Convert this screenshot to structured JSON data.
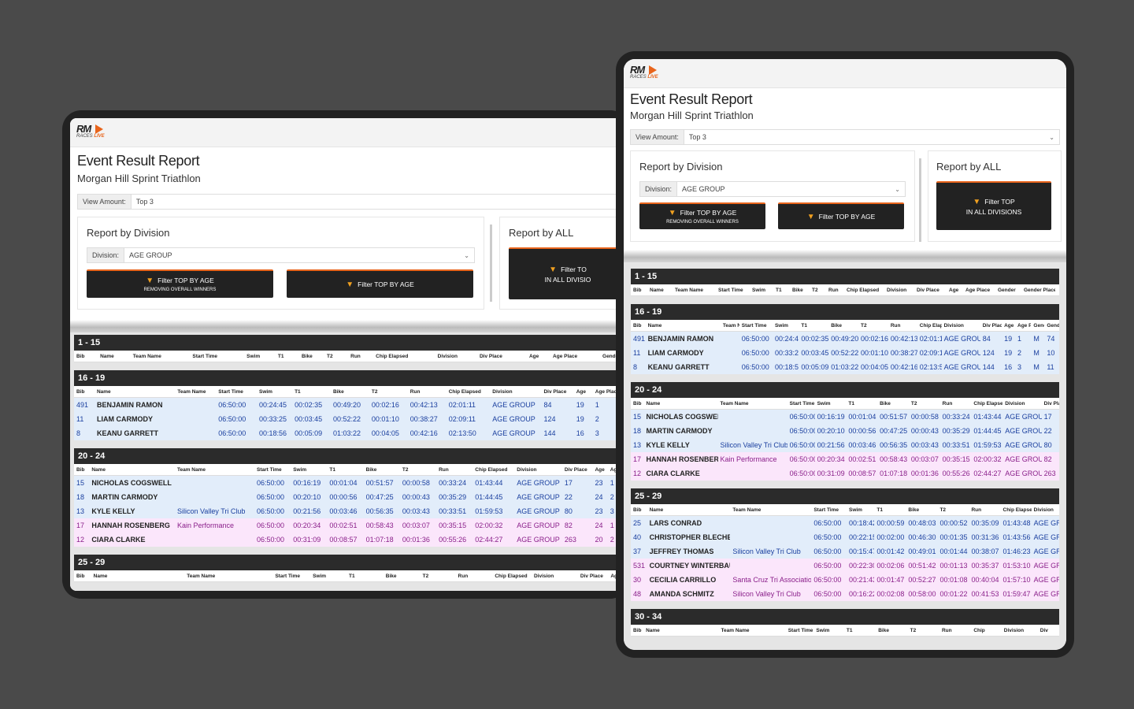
{
  "logo": {
    "mark": "RM",
    "sub_a": "RACES",
    "sub_b": "LIVE"
  },
  "report": {
    "title": "Event Result Report",
    "subtitle": "Morgan Hill Sprint Triathlon",
    "view_amount_label": "View Amount:",
    "view_amount_value": "Top 3",
    "by_division_title": "Report by Division",
    "division_label": "Division:",
    "division_value": "AGE GROUP",
    "btn_filter_top_removing": "Filter TOP BY AGE",
    "btn_filter_top_removing_sub": "REMOVING OVERALL WINNERS",
    "btn_filter_top": "Filter TOP BY AGE",
    "by_all_title": "Report by ALL",
    "btn_all_line1": "Filter TOP",
    "btn_all_line2": "IN ALL DIVISIONS",
    "btn_all_left_line1": "Filter TO",
    "btn_all_left_line2": "IN ALL DIVISIO"
  },
  "columns": [
    "Bib",
    "Name",
    "Team Name",
    "Start Time",
    "Swim",
    "T1",
    "Bike",
    "T2",
    "Run",
    "Chip Elapsed",
    "Division",
    "Div Place",
    "Age",
    "Age Place",
    "Gender",
    "Gender Place"
  ],
  "columns_right_16": [
    "Bib",
    "Name",
    "Team Name",
    "Start Time",
    "Swim",
    "T1",
    "Bike",
    "T2",
    "Run",
    "Chip Elapsed",
    "Division",
    "Div Place",
    "Age",
    "Age Place",
    "Gender",
    "Gender Pla"
  ],
  "columns_right_20": [
    "Bib",
    "Name",
    "Team Name",
    "Start Time",
    "Swim",
    "T1",
    "Bike",
    "T2",
    "Run",
    "Chip Elapsed",
    "Division",
    "Div Place"
  ],
  "columns_right_25": [
    "Bib",
    "Name",
    "Team Name",
    "Start Time",
    "Swim",
    "T1",
    "Bike",
    "T2",
    "Run",
    "Chip Elapsed",
    "Division"
  ],
  "columns_right_30": [
    "Bib",
    "Name",
    "Team Name",
    "Start Time",
    "Swim",
    "T1",
    "Bike",
    "T2",
    "Run",
    "Chip",
    "Division",
    "Div"
  ],
  "columns_left_1": [
    "Bib",
    "Name",
    "Team Name",
    "Start Time",
    "Swim",
    "T1",
    "Bike",
    "T2",
    "Run",
    "Chip Elapsed",
    "Division",
    "Div Place",
    "Age",
    "Age Place",
    "Gender"
  ],
  "columns_left_16": [
    "Bib",
    "Name",
    "Team Name",
    "Start Time",
    "Swim",
    "T1",
    "Bike",
    "T2",
    "Run",
    "Chip Elapsed",
    "Division",
    "Div Place",
    "Age",
    "Age Place"
  ],
  "columns_left_20": [
    "Bib",
    "Name",
    "Team Name",
    "Start Time",
    "Swim",
    "T1",
    "Bike",
    "T2",
    "Run",
    "Chip Elapsed",
    "Division",
    "Div Place",
    "Age",
    "Age Pl"
  ],
  "columns_left_25": [
    "Bib",
    "Name",
    "Team Name",
    "Start Time",
    "Swim",
    "T1",
    "Bike",
    "T2",
    "Run",
    "Chip Elapsed",
    "Division",
    "Div Place",
    "Age"
  ],
  "groups": [
    {
      "label": "1 - 15",
      "rows": []
    },
    {
      "label": "16 - 19",
      "rows": [
        {
          "g": "m",
          "bib": "491",
          "name": "BENJAMIN RAMON",
          "team": "",
          "start": "06:50:00",
          "swim": "00:24:45",
          "t1": "00:02:35",
          "bike": "00:49:20",
          "t2": "00:02:16",
          "run": "00:42:13",
          "chip": "02:01:11",
          "div": "AGE GROUP",
          "divp": "84",
          "age": "19",
          "agep": "1",
          "gender": "M",
          "genp": "74"
        },
        {
          "g": "m",
          "bib": "11",
          "name": "LIAM CARMODY",
          "team": "",
          "start": "06:50:00",
          "swim": "00:33:25",
          "t1": "00:03:45",
          "bike": "00:52:22",
          "t2": "00:01:10",
          "run": "00:38:27",
          "chip": "02:09:11",
          "div": "AGE GROUP",
          "divp": "124",
          "age": "19",
          "agep": "2",
          "gender": "M",
          "genp": "10"
        },
        {
          "g": "m",
          "bib": "8",
          "name": "KEANU GARRETT",
          "team": "",
          "start": "06:50:00",
          "swim": "00:18:56",
          "t1": "00:05:09",
          "bike": "01:03:22",
          "t2": "00:04:05",
          "run": "00:42:16",
          "chip": "02:13:50",
          "div": "AGE GROUP",
          "divp": "144",
          "age": "16",
          "agep": "3",
          "gender": "M",
          "genp": "11"
        }
      ]
    },
    {
      "label": "20 - 24",
      "rows": [
        {
          "g": "m",
          "bib": "15",
          "name": "NICHOLAS COGSWELL",
          "team": "",
          "start": "06:50:00",
          "swim": "00:16:19",
          "t1": "00:01:04",
          "bike": "00:51:57",
          "t2": "00:00:58",
          "run": "00:33:24",
          "chip": "01:43:44",
          "div": "AGE GROUP",
          "divp": "17",
          "age": "23",
          "agep": "1"
        },
        {
          "g": "m",
          "bib": "18",
          "name": "MARTIN CARMODY",
          "team": "",
          "start": "06:50:00",
          "swim": "00:20:10",
          "t1": "00:00:56",
          "bike": "00:47:25",
          "t2": "00:00:43",
          "run": "00:35:29",
          "chip": "01:44:45",
          "div": "AGE GROUP",
          "divp": "22",
          "age": "24",
          "agep": "2"
        },
        {
          "g": "m",
          "bib": "13",
          "name": "KYLE KELLY",
          "team": "Silicon Valley Tri Club",
          "start": "06:50:00",
          "swim": "00:21:56",
          "t1": "00:03:46",
          "bike": "00:56:35",
          "t2": "00:03:43",
          "run": "00:33:51",
          "chip": "01:59:53",
          "div": "AGE GROUP",
          "divp": "80",
          "age": "23",
          "agep": "3"
        },
        {
          "g": "f",
          "bib": "17",
          "name": "HANNAH ROSENBERG",
          "team": "Kain Performance",
          "start": "06:50:00",
          "swim": "00:20:34",
          "t1": "00:02:51",
          "bike": "00:58:43",
          "t2": "00:03:07",
          "run": "00:35:15",
          "chip": "02:00:32",
          "div": "AGE GROUP",
          "divp": "82",
          "age": "24",
          "agep": "1"
        },
        {
          "g": "f",
          "bib": "12",
          "name": "CIARA CLARKE",
          "team": "",
          "start": "06:50:00",
          "swim": "00:31:09",
          "t1": "00:08:57",
          "bike": "01:07:18",
          "t2": "00:01:36",
          "run": "00:55:26",
          "chip": "02:44:27",
          "div": "AGE GROUP",
          "divp": "263",
          "age": "20",
          "agep": "2"
        }
      ]
    },
    {
      "label": "25 - 29",
      "rows": [
        {
          "g": "m",
          "bib": "25",
          "name": "LARS CONRAD",
          "team": "",
          "start": "06:50:00",
          "swim": "00:18:42",
          "t1": "00:00:59",
          "bike": "00:48:03",
          "t2": "00:00:52",
          "run": "00:35:09",
          "chip": "01:43:48",
          "div": "AGE GRO"
        },
        {
          "g": "m",
          "bib": "40",
          "name": "CHRISTOPHER BLECHER",
          "team": "",
          "start": "06:50:00",
          "swim": "00:22:15",
          "t1": "00:02:00",
          "bike": "00:46:30",
          "t2": "00:01:35",
          "run": "00:31:36",
          "chip": "01:43:56",
          "div": "AGE GRO"
        },
        {
          "g": "m",
          "bib": "37",
          "name": "JEFFREY THOMAS",
          "team": "Silicon Valley Tri Club",
          "start": "06:50:00",
          "swim": "00:15:47",
          "t1": "00:01:42",
          "bike": "00:49:01",
          "t2": "00:01:44",
          "run": "00:38:07",
          "chip": "01:46:23",
          "div": "AGE GRO"
        },
        {
          "g": "f",
          "bib": "531",
          "name": "COURTNEY WINTERBAUER",
          "team": "",
          "start": "06:50:00",
          "swim": "00:22:30",
          "t1": "00:02:06",
          "bike": "00:51:42",
          "t2": "00:01:13",
          "run": "00:35:37",
          "chip": "01:53:10",
          "div": "AGE GRO"
        },
        {
          "g": "f",
          "bib": "30",
          "name": "CECILIA CARRILLO",
          "team": "Santa Cruz Tri Association",
          "start": "06:50:00",
          "swim": "00:21:43",
          "t1": "00:01:47",
          "bike": "00:52:27",
          "t2": "00:01:08",
          "run": "00:40:04",
          "chip": "01:57:10",
          "div": "AGE GRO"
        },
        {
          "g": "f",
          "bib": "48",
          "name": "AMANDA SCHMITZ",
          "team": "Silicon Valley Tri Club",
          "start": "06:50:00",
          "swim": "00:16:22",
          "t1": "00:02:08",
          "bike": "00:58:00",
          "t2": "00:01:22",
          "run": "00:41:53",
          "chip": "01:59:47",
          "div": "AGE GRO"
        }
      ]
    },
    {
      "label": "30 - 34",
      "rows": []
    }
  ]
}
